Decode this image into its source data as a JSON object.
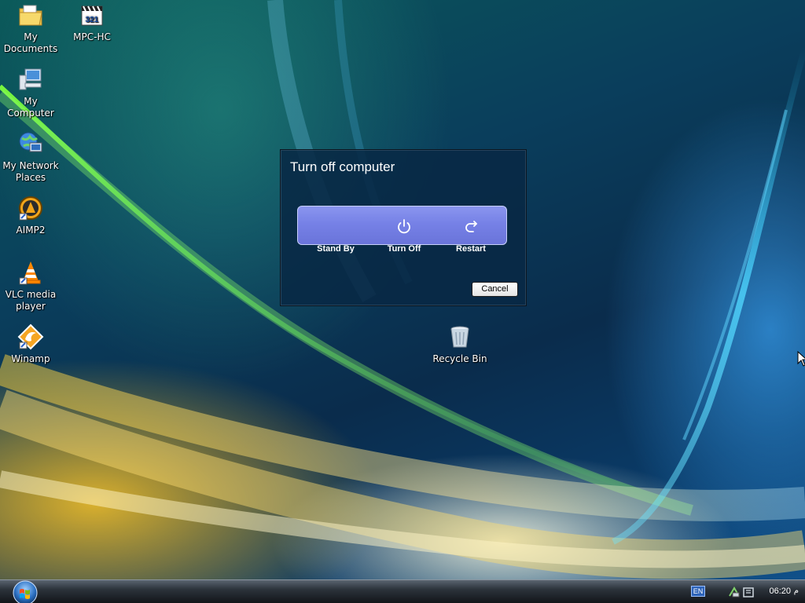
{
  "desktop": {
    "icons": [
      {
        "label": "My\nDocuments",
        "icon": "my-documents-icon"
      },
      {
        "label": "MPC-HC",
        "icon": "mpc-hc-icon"
      },
      {
        "label": "My Computer",
        "icon": "my-computer-icon"
      },
      {
        "label": "My Network\nPlaces",
        "icon": "network-places-icon"
      },
      {
        "label": "AIMP2",
        "icon": "aimp-icon"
      },
      {
        "label": "VLC media\nplayer",
        "icon": "vlc-icon"
      },
      {
        "label": "Winamp",
        "icon": "winamp-icon"
      },
      {
        "label": "Recycle Bin",
        "icon": "recycle-bin-icon"
      }
    ],
    "mpc_badge": "321"
  },
  "dialog": {
    "title": "Turn off computer",
    "options": [
      {
        "label": "Stand By",
        "icon": "moon-icon"
      },
      {
        "label": "Turn Off",
        "icon": "power-icon"
      },
      {
        "label": "Restart",
        "icon": "restart-arrow-icon"
      }
    ],
    "cancel_label": "Cancel"
  },
  "taskbar": {
    "language": "EN",
    "clock": "06:20",
    "clock_suffix": "م"
  },
  "colors": {
    "dialog_bg": "#08283f",
    "options_panel": "#7681e6",
    "taskbar": "#2c333b"
  }
}
